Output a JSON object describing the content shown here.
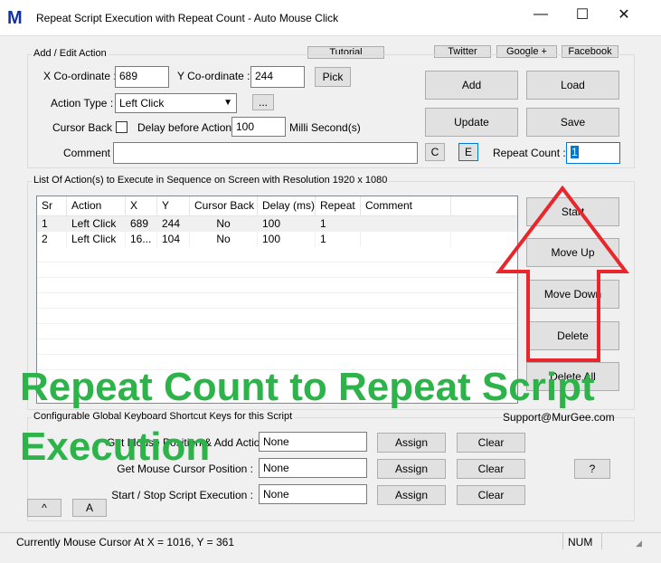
{
  "window": {
    "title": "Repeat Script Execution with Repeat Count - Auto Mouse Click",
    "app_icon_letter": "M"
  },
  "links": {
    "tutorial": "Tutorial",
    "twitter": "Twitter",
    "google": "Google +",
    "facebook": "Facebook"
  },
  "edit_group": {
    "label": "Add / Edit Action",
    "x_label": "X Co-ordinate :",
    "x_value": "689",
    "y_label": "Y Co-ordinate :",
    "y_value": "244",
    "pick": "Pick",
    "action_type_label": "Action Type :",
    "action_type_value": "Left Click",
    "more": "...",
    "cursor_back_label": "Cursor Back :",
    "delay_label": "Delay before Action :",
    "delay_value": "100",
    "delay_unit": "Milli Second(s)",
    "comment_label": "Comment :",
    "comment_value": "",
    "c_btn": "C",
    "e_btn": "E",
    "repeat_label": "Repeat Count :",
    "repeat_value": "1"
  },
  "actions": {
    "add": "Add",
    "load": "Load",
    "update": "Update",
    "save": "Save"
  },
  "list_group": {
    "label": "List Of Action(s) to Execute in Sequence on Screen with Resolution 1920 x 1080",
    "columns": [
      "Sr",
      "Action",
      "X",
      "Y",
      "Cursor Back",
      "Delay (ms)",
      "Repeat",
      "Comment"
    ],
    "rows": [
      [
        "1",
        "Left Click",
        "689",
        "244",
        "No",
        "100",
        "1",
        ""
      ],
      [
        "2",
        "Left Click",
        "16...",
        "104",
        "No",
        "100",
        "1",
        ""
      ]
    ]
  },
  "side_buttons": {
    "start": "Start",
    "move_up": "Move Up",
    "move_down": "Move Down",
    "delete": "Delete",
    "delete_all": "Delete All"
  },
  "shortcut_group": {
    "label": "Configurable Global Keyboard Shortcut Keys for this Script",
    "support": "Support@MurGee.com",
    "rows": [
      {
        "label": "Get Mouse Position & Add Action :",
        "value": "None",
        "assign": "Assign",
        "clear": "Clear"
      },
      {
        "label": "Get Mouse Cursor Position :",
        "value": "None",
        "assign": "Assign",
        "clear": "Clear"
      },
      {
        "label": "Start / Stop Script Execution :",
        "value": "None",
        "assign": "Assign",
        "clear": "Clear"
      }
    ],
    "help": "?"
  },
  "bottom_buttons": {
    "caret": "^",
    "a": "A"
  },
  "status": {
    "text": "Currently Mouse Cursor At X = 1016, Y = 361",
    "num": "NUM"
  },
  "overlay": {
    "line1": "Repeat Count to Repeat Script",
    "line2": "Execution",
    "arrow_color": "#e8262b",
    "text_color": "#2db34a"
  }
}
